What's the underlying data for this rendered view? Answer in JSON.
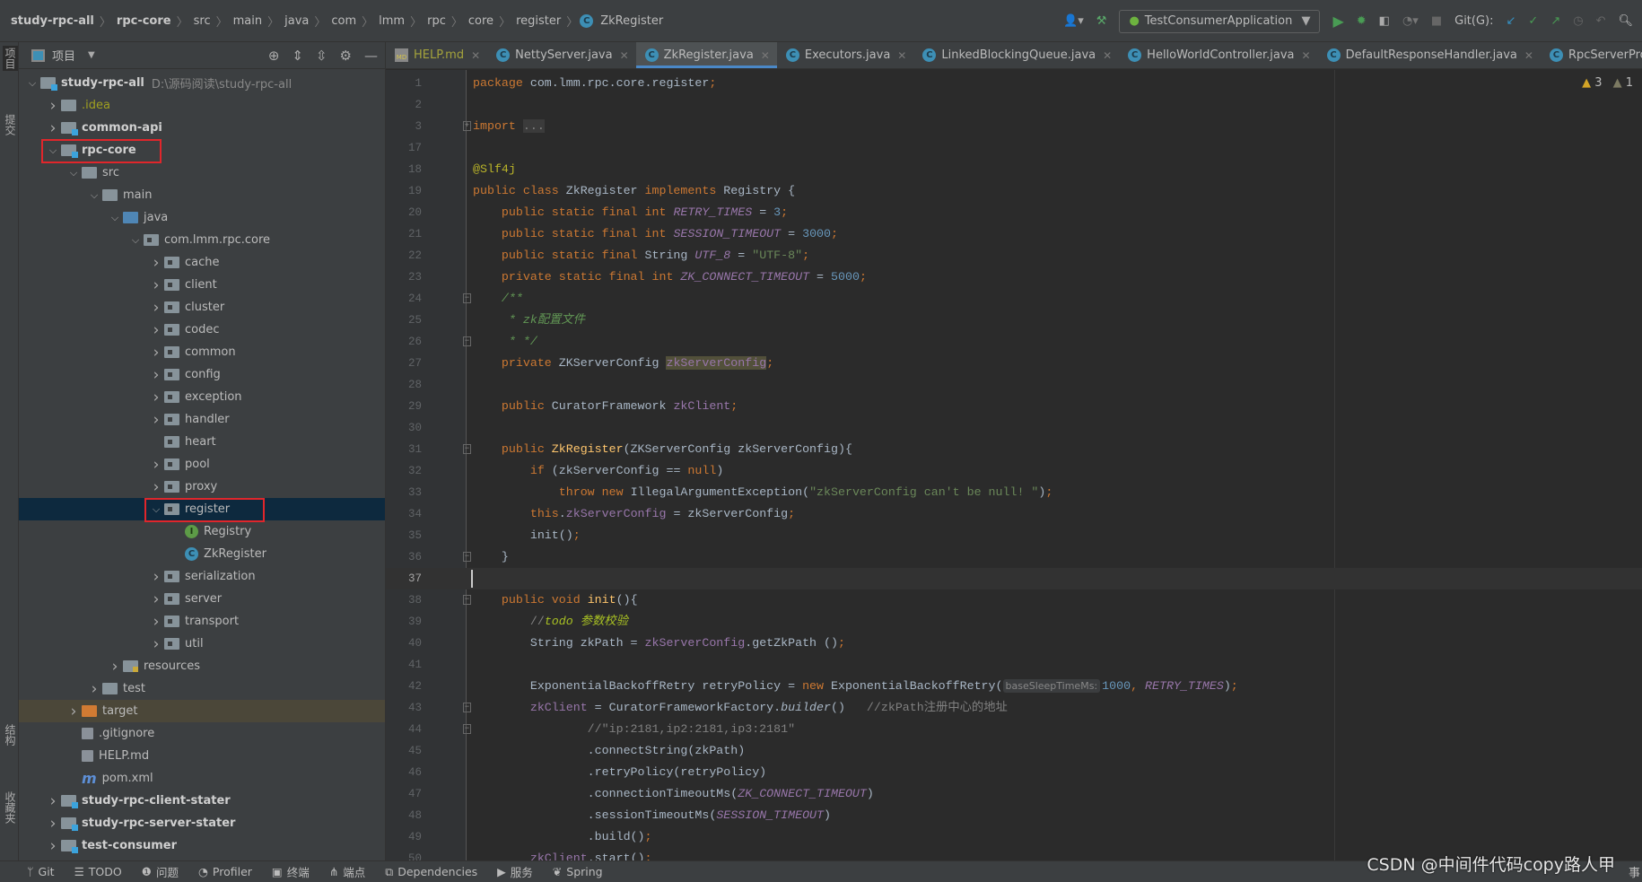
{
  "breadcrumb": [
    "study-rpc-all",
    "rpc-core",
    "src",
    "main",
    "java",
    "com",
    "lmm",
    "rpc",
    "core",
    "register",
    "ZkRegister"
  ],
  "toolbar": {
    "run_config": "TestConsumerApplication",
    "git_label": "Git(G):"
  },
  "left_strip": [
    "项目",
    "提交",
    "结构",
    "收藏夹"
  ],
  "project_panel": {
    "title": "项目",
    "root_path": "D:\\源码阅读\\study-rpc-all"
  },
  "tree": [
    {
      "label": "study-rpc-all",
      "level": 0,
      "arrow": "down",
      "icon": "module",
      "bold": true,
      "path": true
    },
    {
      "label": ".idea",
      "level": 1,
      "arrow": "right",
      "icon": "folder",
      "color": "#a0a020"
    },
    {
      "label": "common-api",
      "level": 1,
      "arrow": "right",
      "icon": "module",
      "bold": true
    },
    {
      "label": "rpc-core",
      "level": 1,
      "arrow": "down",
      "icon": "module",
      "bold": true,
      "boxed": true
    },
    {
      "label": "src",
      "level": 2,
      "arrow": "down",
      "icon": "folder"
    },
    {
      "label": "main",
      "level": 3,
      "arrow": "down",
      "icon": "folder"
    },
    {
      "label": "java",
      "level": 4,
      "arrow": "down",
      "icon": "src"
    },
    {
      "label": "com.lmm.rpc.core",
      "level": 5,
      "arrow": "down",
      "icon": "pkg"
    },
    {
      "label": "cache",
      "level": 6,
      "arrow": "right",
      "icon": "pkg"
    },
    {
      "label": "client",
      "level": 6,
      "arrow": "right",
      "icon": "pkg"
    },
    {
      "label": "cluster",
      "level": 6,
      "arrow": "right",
      "icon": "pkg"
    },
    {
      "label": "codec",
      "level": 6,
      "arrow": "right",
      "icon": "pkg"
    },
    {
      "label": "common",
      "level": 6,
      "arrow": "right",
      "icon": "pkg"
    },
    {
      "label": "config",
      "level": 6,
      "arrow": "right",
      "icon": "pkg"
    },
    {
      "label": "exception",
      "level": 6,
      "arrow": "right",
      "icon": "pkg"
    },
    {
      "label": "handler",
      "level": 6,
      "arrow": "right",
      "icon": "pkg"
    },
    {
      "label": "heart",
      "level": 6,
      "arrow": "",
      "icon": "pkg"
    },
    {
      "label": "pool",
      "level": 6,
      "arrow": "right",
      "icon": "pkg"
    },
    {
      "label": "proxy",
      "level": 6,
      "arrow": "right",
      "icon": "pkg"
    },
    {
      "label": "register",
      "level": 6,
      "arrow": "down",
      "icon": "pkg",
      "selected": true,
      "boxed": true
    },
    {
      "label": "Registry",
      "level": 7,
      "arrow": "",
      "icon": "interface"
    },
    {
      "label": "ZkRegister",
      "level": 7,
      "arrow": "",
      "icon": "class"
    },
    {
      "label": "serialization",
      "level": 6,
      "arrow": "right",
      "icon": "pkg"
    },
    {
      "label": "server",
      "level": 6,
      "arrow": "right",
      "icon": "pkg"
    },
    {
      "label": "transport",
      "level": 6,
      "arrow": "right",
      "icon": "pkg"
    },
    {
      "label": "util",
      "level": 6,
      "arrow": "right",
      "icon": "pkg"
    },
    {
      "label": "resources",
      "level": 4,
      "arrow": "right",
      "icon": "res"
    },
    {
      "label": "test",
      "level": 3,
      "arrow": "right",
      "icon": "folder"
    },
    {
      "label": "target",
      "level": 2,
      "arrow": "right",
      "icon": "target",
      "highlight": true
    },
    {
      "label": ".gitignore",
      "level": 2,
      "arrow": "",
      "icon": "file"
    },
    {
      "label": "HELP.md",
      "level": 2,
      "arrow": "",
      "icon": "file"
    },
    {
      "label": "pom.xml",
      "level": 2,
      "arrow": "",
      "icon": "maven"
    },
    {
      "label": "study-rpc-client-stater",
      "level": 1,
      "arrow": "right",
      "icon": "module",
      "bold": true
    },
    {
      "label": "study-rpc-server-stater",
      "level": 1,
      "arrow": "right",
      "icon": "module",
      "bold": true
    },
    {
      "label": "test-consumer",
      "level": 1,
      "arrow": "right",
      "icon": "module",
      "bold": true
    }
  ],
  "tabs": [
    {
      "label": "HELP.md",
      "icon": "md",
      "color": "#a4a33c"
    },
    {
      "label": "NettyServer.java",
      "icon": "class"
    },
    {
      "label": "ZkRegister.java",
      "icon": "class",
      "active": true
    },
    {
      "label": "Executors.java",
      "icon": "class"
    },
    {
      "label": "LinkedBlockingQueue.java",
      "icon": "class"
    },
    {
      "label": "HelloWorldController.java",
      "icon": "class"
    },
    {
      "label": "DefaultResponseHandler.java",
      "icon": "class"
    },
    {
      "label": "RpcServerProcessor.java",
      "icon": "class"
    }
  ],
  "inspections": {
    "warnings": "3",
    "weak_warnings": "1"
  },
  "code": [
    {
      "n": "1",
      "t": [
        [
          "kw",
          "package"
        ],
        [
          "pl",
          " com.lmm.rpc.core.register"
        ],
        [
          "kw",
          ";"
        ]
      ]
    },
    {
      "n": "2",
      "t": []
    },
    {
      "n": "3",
      "fold": "+",
      "t": [
        [
          "kw",
          "import"
        ],
        [
          "pl",
          " "
        ],
        [
          "fold3",
          "..."
        ]
      ]
    },
    {
      "n": "17",
      "t": []
    },
    {
      "n": "18",
      "t": [
        [
          "an",
          "@Slf4j"
        ]
      ]
    },
    {
      "n": "19",
      "t": [
        [
          "kw",
          "public class "
        ],
        [
          "pl",
          "ZkRegister "
        ],
        [
          "kw",
          "implements "
        ],
        [
          "pl",
          "Registry {"
        ]
      ]
    },
    {
      "n": "20",
      "t": [
        [
          "pl",
          "    "
        ],
        [
          "kw",
          "public static final int "
        ],
        [
          "co",
          "RETRY_TIMES"
        ],
        [
          "pl",
          " = "
        ],
        [
          "nu",
          "3"
        ],
        [
          "kw",
          ";"
        ]
      ]
    },
    {
      "n": "21",
      "t": [
        [
          "pl",
          "    "
        ],
        [
          "kw",
          "public static final int "
        ],
        [
          "co",
          "SESSION_TIMEOUT"
        ],
        [
          "pl",
          " = "
        ],
        [
          "nu",
          "3000"
        ],
        [
          "kw",
          ";"
        ]
      ]
    },
    {
      "n": "22",
      "t": [
        [
          "pl",
          "    "
        ],
        [
          "kw",
          "public static final "
        ],
        [
          "pl",
          "String "
        ],
        [
          "co",
          "UTF_8"
        ],
        [
          "pl",
          " = "
        ],
        [
          "st",
          "\"UTF-8\""
        ],
        [
          "kw",
          ";"
        ]
      ]
    },
    {
      "n": "23",
      "t": [
        [
          "pl",
          "    "
        ],
        [
          "kw",
          "private static final int "
        ],
        [
          "co",
          "ZK_CONNECT_TIMEOUT"
        ],
        [
          "pl",
          " = "
        ],
        [
          "nu",
          "5000"
        ],
        [
          "kw",
          ";"
        ]
      ]
    },
    {
      "n": "24",
      "fold": "-",
      "t": [
        [
          "pl",
          "    "
        ],
        [
          "dc",
          "/**"
        ]
      ]
    },
    {
      "n": "25",
      "t": [
        [
          "pl",
          "     "
        ],
        [
          "dc",
          "* zk配置文件"
        ]
      ]
    },
    {
      "n": "26",
      "fold": "-",
      "t": [
        [
          "pl",
          "     "
        ],
        [
          "dc",
          "* */"
        ]
      ]
    },
    {
      "n": "27",
      "t": [
        [
          "pl",
          "    "
        ],
        [
          "kw",
          "private "
        ],
        [
          "pl",
          "ZKServerConfig "
        ],
        [
          "fhl",
          "zkServerConfig"
        ],
        [
          "kw",
          ";"
        ]
      ]
    },
    {
      "n": "28",
      "t": []
    },
    {
      "n": "29",
      "t": [
        [
          "pl",
          "    "
        ],
        [
          "kw",
          "public "
        ],
        [
          "pl",
          "CuratorFramework "
        ],
        [
          "fd",
          "zkClient"
        ],
        [
          "kw",
          ";"
        ]
      ]
    },
    {
      "n": "30",
      "t": []
    },
    {
      "n": "31",
      "fold": "-",
      "t": [
        [
          "pl",
          "    "
        ],
        [
          "kw",
          "public "
        ],
        [
          "fn",
          "ZkRegister"
        ],
        [
          "pl",
          "(ZKServerConfig zkServerConfig){"
        ]
      ]
    },
    {
      "n": "32",
      "t": [
        [
          "pl",
          "        "
        ],
        [
          "kw",
          "if "
        ],
        [
          "pl",
          "(zkServerConfig == "
        ],
        [
          "kw",
          "null"
        ],
        [
          "pl",
          ")"
        ]
      ]
    },
    {
      "n": "33",
      "t": [
        [
          "pl",
          "            "
        ],
        [
          "kw",
          "throw new "
        ],
        [
          "pl",
          "IllegalArgumentException("
        ],
        [
          "st",
          "\"zkServerConfig can't be null! \""
        ],
        [
          "pl",
          ")"
        ],
        [
          "kw",
          ";"
        ]
      ]
    },
    {
      "n": "34",
      "t": [
        [
          "pl",
          "        "
        ],
        [
          "kw",
          "this"
        ],
        [
          "pl",
          "."
        ],
        [
          "fd",
          "zkServerConfig"
        ],
        [
          "pl",
          " = zkServerConfig"
        ],
        [
          "kw",
          ";"
        ]
      ]
    },
    {
      "n": "35",
      "t": [
        [
          "pl",
          "        init()"
        ],
        [
          "kw",
          ";"
        ]
      ]
    },
    {
      "n": "36",
      "fold": "-",
      "t": [
        [
          "pl",
          "    }"
        ]
      ]
    },
    {
      "n": "37",
      "current": true,
      "t": []
    },
    {
      "n": "38",
      "fold": "-",
      "t": [
        [
          "pl",
          "    "
        ],
        [
          "kw",
          "public void "
        ],
        [
          "fn",
          "init"
        ],
        [
          "pl",
          "(){"
        ]
      ]
    },
    {
      "n": "39",
      "t": [
        [
          "pl",
          "        "
        ],
        [
          "cm",
          "//"
        ],
        [
          "td",
          "todo 参数校验"
        ]
      ]
    },
    {
      "n": "40",
      "t": [
        [
          "pl",
          "        String zkPath = "
        ],
        [
          "fd",
          "zkServerConfig"
        ],
        [
          "pl",
          ".getZkPath ()"
        ],
        [
          "kw",
          ";"
        ]
      ]
    },
    {
      "n": "41",
      "t": []
    },
    {
      "n": "42",
      "t": [
        [
          "pl",
          "        ExponentialBackoffRetry retryPolicy = "
        ],
        [
          "kw",
          "new "
        ],
        [
          "pl",
          "ExponentialBackoffRetry("
        ],
        [
          "hint",
          "baseSleepTimeMs:"
        ],
        [
          "nu",
          "1000"
        ],
        [
          "kw",
          ", "
        ],
        [
          "co",
          "RETRY_TIMES"
        ],
        [
          "pl",
          ")"
        ],
        [
          "kw",
          ";"
        ]
      ]
    },
    {
      "n": "43",
      "fold": "-",
      "t": [
        [
          "pl",
          "        "
        ],
        [
          "fd",
          "zkClient"
        ],
        [
          "pl",
          " = CuratorFrameworkFactory."
        ],
        [
          "it",
          "builder"
        ],
        [
          "pl",
          "()   "
        ],
        [
          "cm",
          "//zkPath注册中心的地址"
        ]
      ]
    },
    {
      "n": "44",
      "fold": "-",
      "t": [
        [
          "pl",
          "                "
        ],
        [
          "cm",
          "//\"ip:2181,ip2:2181,ip3:2181\""
        ]
      ]
    },
    {
      "n": "45",
      "t": [
        [
          "pl",
          "                .connectString(zkPath)"
        ]
      ]
    },
    {
      "n": "46",
      "t": [
        [
          "pl",
          "                .retryPolicy(retryPolicy)"
        ]
      ]
    },
    {
      "n": "47",
      "t": [
        [
          "pl",
          "                .connectionTimeoutMs("
        ],
        [
          "co",
          "ZK_CONNECT_TIMEOUT"
        ],
        [
          "pl",
          ")"
        ]
      ]
    },
    {
      "n": "48",
      "t": [
        [
          "pl",
          "                .sessionTimeoutMs("
        ],
        [
          "co",
          "SESSION_TIMEOUT"
        ],
        [
          "pl",
          ")"
        ]
      ]
    },
    {
      "n": "49",
      "t": [
        [
          "pl",
          "                .build()"
        ],
        [
          "kw",
          ";"
        ]
      ]
    },
    {
      "n": "50",
      "t": [
        [
          "pl",
          "        "
        ],
        [
          "fd",
          "zkClient"
        ],
        [
          "pl",
          ".start()"
        ],
        [
          "kw",
          ";"
        ]
      ]
    }
  ],
  "bottom_bar": [
    {
      "label": "Git",
      "icon": "git-icon"
    },
    {
      "label": "TODO",
      "icon": "list-icon"
    },
    {
      "label": "问题",
      "icon": "problems-icon"
    },
    {
      "label": "Profiler",
      "icon": "profiler-icon"
    },
    {
      "label": "终端",
      "icon": "terminal-icon"
    },
    {
      "label": "端点",
      "icon": "endpoints-icon"
    },
    {
      "label": "Dependencies",
      "icon": "dependencies-icon"
    },
    {
      "label": "服务",
      "icon": "services-icon"
    },
    {
      "label": "Spring",
      "icon": "spring-icon"
    }
  ],
  "watermark": "CSDN @中间件代码copy路人甲",
  "event_log": "事"
}
